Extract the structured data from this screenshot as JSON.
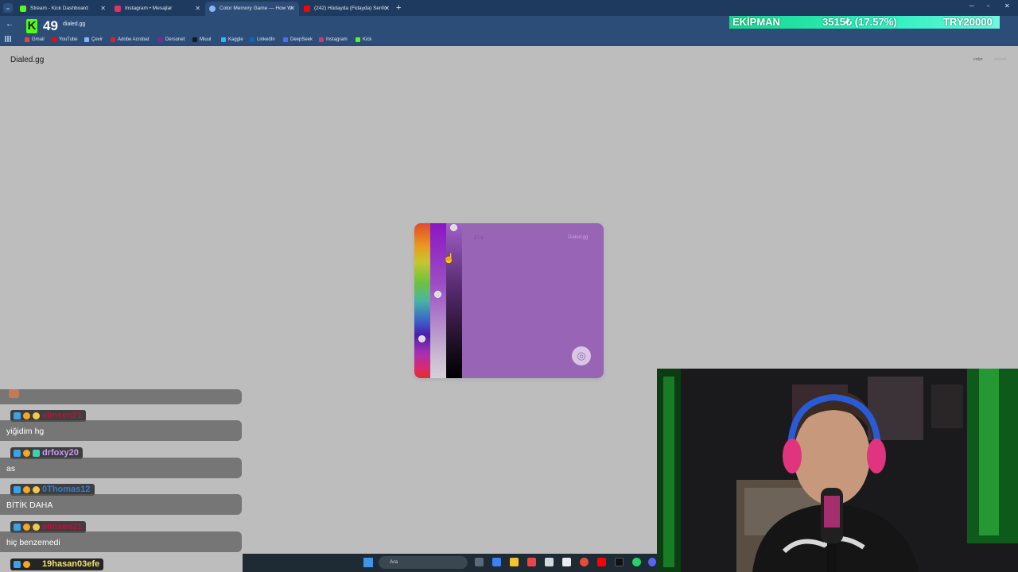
{
  "browser": {
    "tabs": [
      {
        "title": "Stream - Kick Dashboard",
        "color": "#53fc18"
      },
      {
        "title": "Instagram • Mesajlar",
        "color": "#e1306c"
      },
      {
        "title": "Color Memory Game — How W",
        "color": "#8ab4f8",
        "active": true
      },
      {
        "title": "(242) Hüdayda (Fidayda) Senfo",
        "color": "#ff0000"
      }
    ],
    "url": "dialed.gg",
    "bookmarks": [
      "Gmail",
      "YouTube",
      "Çevir",
      "Adobe Acrobat",
      "Dersonet",
      "Miuul",
      "Kaggle",
      "LinkedIn",
      "DeepSeek",
      "Instagram",
      "Kick"
    ]
  },
  "stream_overlay": {
    "viewer_count": "49",
    "goal_label": "EKİPMAN",
    "goal_progress": "3515₺ (17.57%)",
    "goal_target": "TRY20000"
  },
  "page": {
    "site_title": "Dialed.gg",
    "top_links": [
      "color",
      "sound"
    ]
  },
  "game": {
    "round": "2 / 6",
    "brand": "Dialed.gg",
    "current_color": "#9865b6",
    "submit_icon": "target-icon"
  },
  "chat": [
    {
      "user": "elmsen21",
      "color": "#c0103a",
      "message": "yiğidim hg"
    },
    {
      "user": "drfoxy20",
      "color": "#c79cf0",
      "message": "as"
    },
    {
      "user": "0Thomas12",
      "color": "#2f7fd8",
      "message": "BİTİK DAHA"
    },
    {
      "user": "elmsen21",
      "color": "#c0103a",
      "message": "hiç benzemedi"
    },
    {
      "user": "19hasan03efe",
      "color": "#f3e26a",
      "message": ""
    }
  ],
  "taskbar": {
    "search_placeholder": "Ara"
  }
}
